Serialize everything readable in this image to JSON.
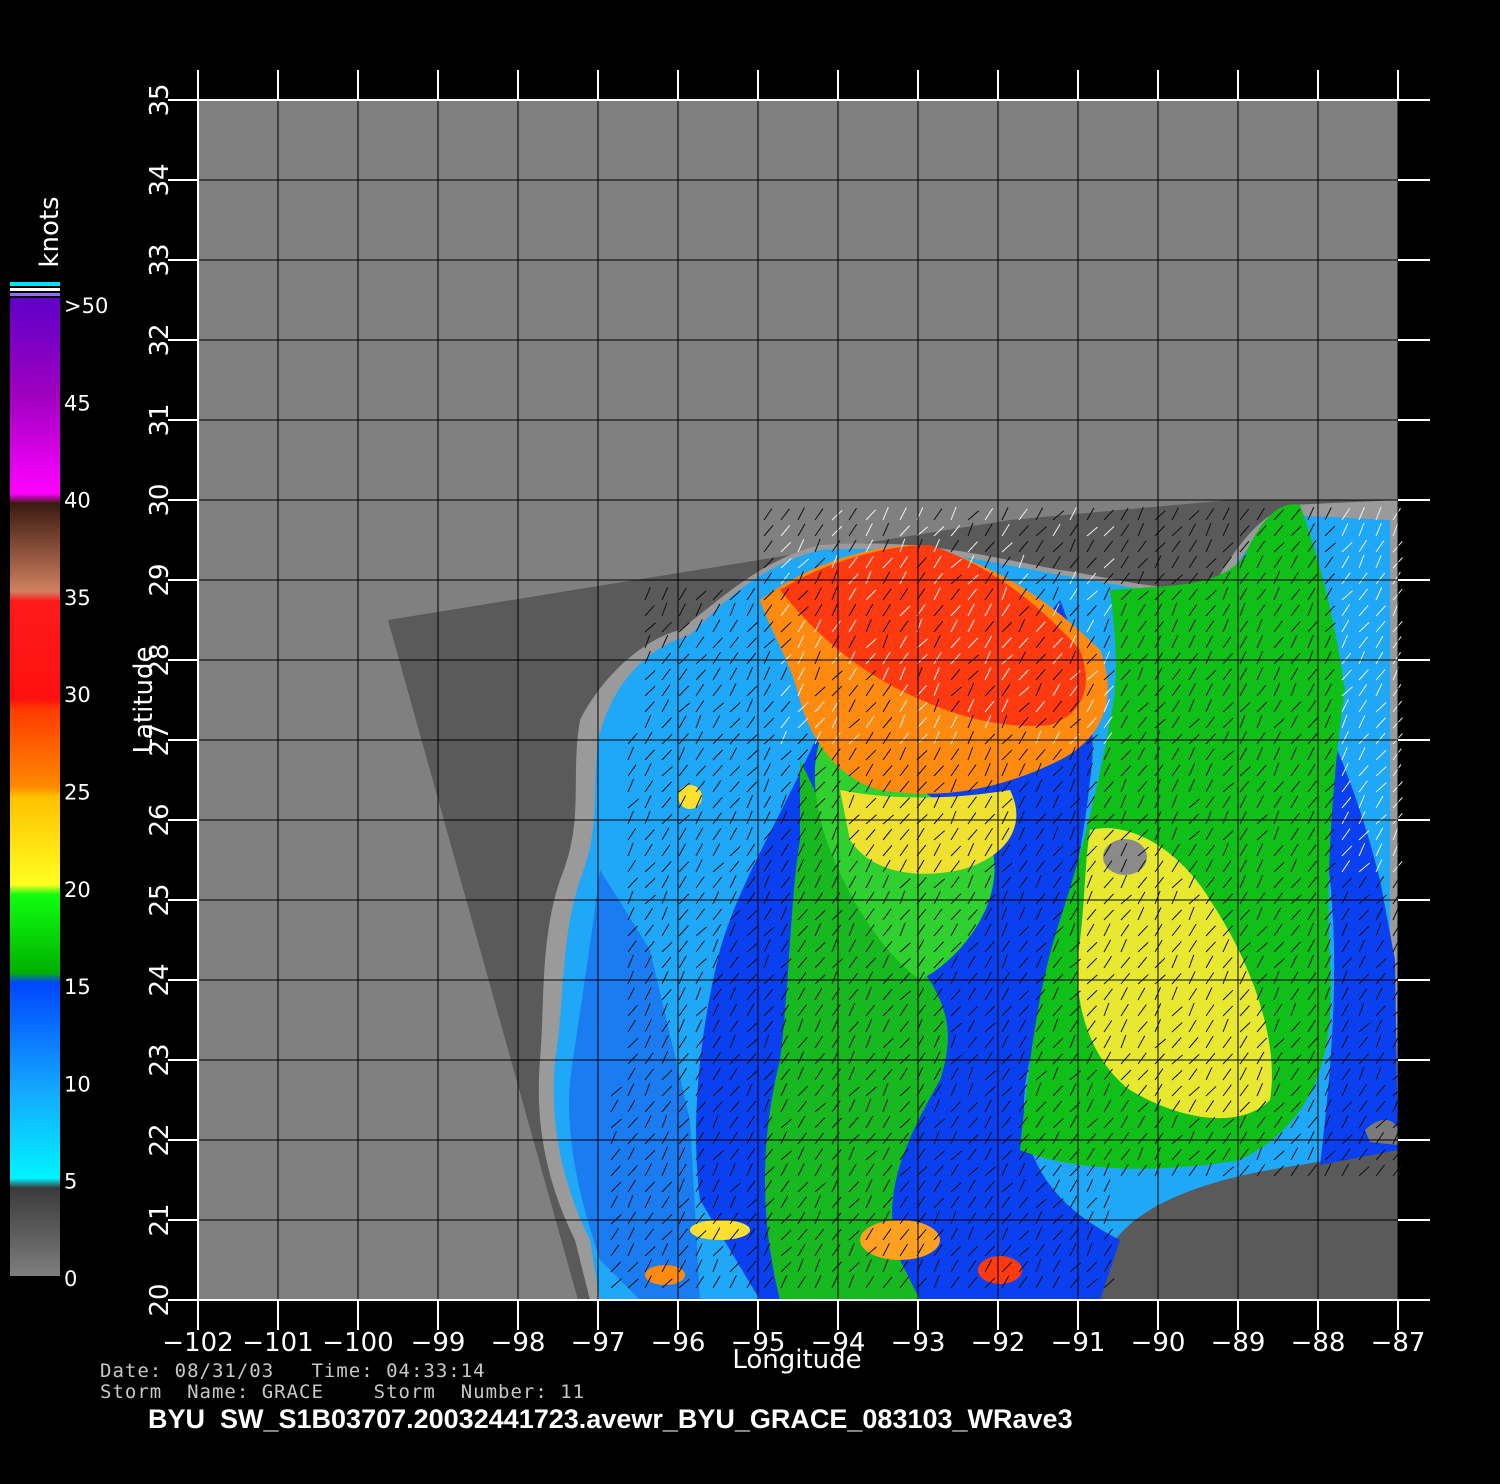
{
  "map": {
    "xlabel": "Longitude",
    "ylabel": "Latitude",
    "lon_ticks": [
      -102,
      -101,
      -100,
      -99,
      -98,
      -97,
      -96,
      -95,
      -94,
      -93,
      -92,
      -91,
      -90,
      -89,
      -88,
      -87
    ],
    "lon_tick_labels": [
      "−102",
      "−101",
      "−100",
      "−99",
      "−98",
      "−97",
      "−96",
      "−95",
      "−94",
      "−93",
      "−92",
      "−91",
      "−90",
      "−89",
      "−88",
      "−87"
    ],
    "lat_ticks": [
      20,
      21,
      22,
      23,
      24,
      25,
      26,
      27,
      28,
      29,
      30,
      31,
      32,
      33,
      34,
      35
    ],
    "lat_tick_labels": [
      "20",
      "21",
      "22",
      "23",
      "24",
      "25",
      "26",
      "27",
      "28",
      "29",
      "30",
      "31",
      "32",
      "33",
      "34",
      "35"
    ],
    "grid": true,
    "background_color": "#808080"
  },
  "colorbar": {
    "unit": "knots",
    "labels": [
      "0",
      "5",
      "10",
      "15",
      "20",
      "25",
      "30",
      "35",
      "40",
      "45",
      ">50"
    ],
    "colors": {
      "gray_low": "#808080",
      "cyan": "#00f0ff",
      "light_blue": "#0a8cff",
      "blue": "#0028f0",
      "green": "#00c800",
      "yellow": "#f0f020",
      "orange": "#ff8c00",
      "red": "#ff1e10",
      "brown": "#7a3a2a",
      "magenta": "#f00af0",
      "purple": "#7a00d0"
    }
  },
  "footer": {
    "line1": "Date: 08/31/03   Time: 04:33:14",
    "line2": "Storm  Name: GRACE    Storm  Number: 11",
    "title": "BYU  SW_S1B03707.20032441723.avewr_BYU_GRACE_083103_WRave3"
  }
}
